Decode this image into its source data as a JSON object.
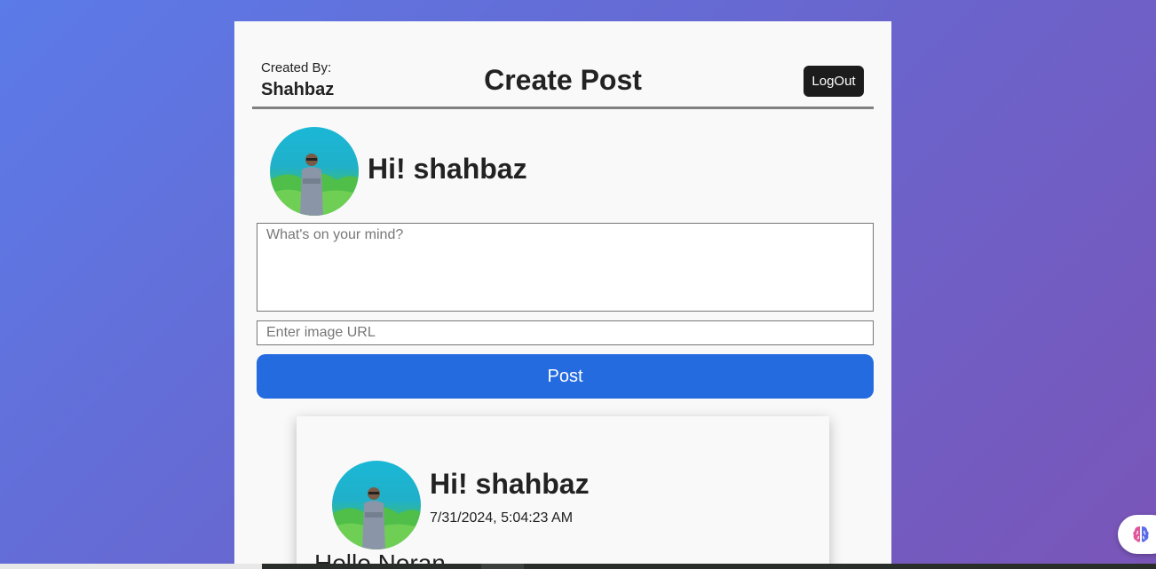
{
  "header": {
    "created_by_label": "Created By:",
    "created_by_name": "Shahbaz",
    "title": "Create Post",
    "logout_label": "LogOut"
  },
  "composer": {
    "greeting": "Hi! shahbaz",
    "text_placeholder": "What's on your mind?",
    "image_url_placeholder": "Enter image URL",
    "post_label": "Post"
  },
  "posts": [
    {
      "user": "Hi! shahbaz",
      "timestamp": "7/31/2024, 5:04:23 AM",
      "text": "Hello Noran"
    }
  ],
  "colors": {
    "post_button": "#246be0",
    "logout_button": "#1c1c1c",
    "card_background": "#f9f9f9"
  },
  "icons": {
    "assistant": "brain-icon"
  }
}
